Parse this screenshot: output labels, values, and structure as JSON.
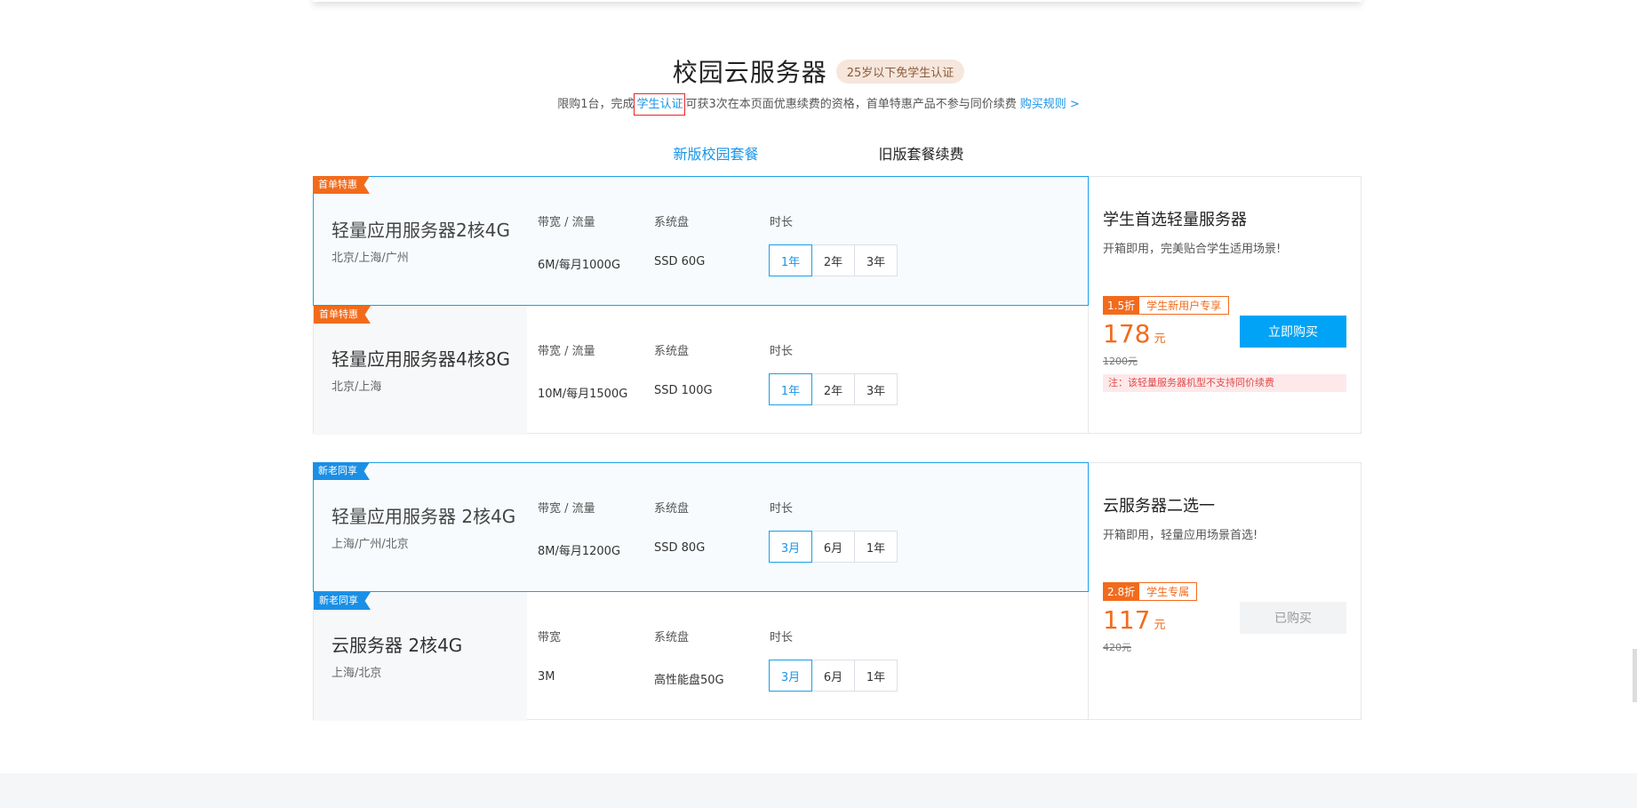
{
  "header": {
    "title": "校园云服务器",
    "badge": "25岁以下免学生认证",
    "sub_before": "限购1台，完成",
    "sub_link": "学生认证",
    "sub_after": "可获3次在本页面优惠续费的资格，首单特惠产品不参与同价续费",
    "sub_rules": "购买规则 >"
  },
  "tabs": [
    {
      "label": "新版校园套餐",
      "active": true
    },
    {
      "label": "旧版套餐续费",
      "active": false
    }
  ],
  "groups": [
    {
      "rows": [
        {
          "tag": "首单特惠",
          "name": "轻量应用服务器2核4G",
          "region": "北京/上海/广州",
          "col1_head": "带宽 / 流量",
          "col1_val": "6M/每月1000G",
          "col2_head": "系统盘",
          "col2_val": "SSD 60G",
          "col3_head": "时长",
          "durations": [
            "1年",
            "2年",
            "3年"
          ]
        },
        {
          "tag": "首单特惠",
          "name": "轻量应用服务器4核8G",
          "region": "北京/上海",
          "col1_head": "带宽 / 流量",
          "col1_val": "10M/每月1500G",
          "col2_head": "系统盘",
          "col2_val": "SSD 100G",
          "col3_head": "时长",
          "durations": [
            "1年",
            "2年",
            "3年"
          ]
        }
      ],
      "panel": {
        "title": "学生首选轻量服务器",
        "desc": "开箱即用，完美贴合学生适用场景!",
        "disc_rate": "1.5折",
        "disc_label": "学生新用户专享",
        "price": "178",
        "unit": "元",
        "orig": "1200元",
        "button": "立即购买",
        "note": "注：该轻量服务器机型不支持同价续费"
      }
    },
    {
      "rows": [
        {
          "tag": "新老同享",
          "name": "轻量应用服务器 2核4G",
          "region": "上海/广州/北京",
          "col1_head": "带宽 / 流量",
          "col1_val": "8M/每月1200G",
          "col2_head": "系统盘",
          "col2_val": "SSD 80G",
          "col3_head": "时长",
          "durations": [
            "3月",
            "6月",
            "1年"
          ]
        },
        {
          "tag": "新老同享",
          "name": "云服务器 2核4G",
          "region": "上海/北京",
          "col1_head": "带宽",
          "col1_val": "3M",
          "col2_head": "系统盘",
          "col2_val": "高性能盘50G",
          "col3_head": "时长",
          "durations": [
            "3月",
            "6月",
            "1年"
          ]
        }
      ],
      "panel": {
        "title": "云服务器二选一",
        "desc": "开箱即用，轻量应用场景首选!",
        "disc_rate": "2.8折",
        "disc_label": "学生专属",
        "price": "117",
        "unit": "元",
        "orig": "420元",
        "button": "已购买"
      }
    }
  ],
  "colors": {
    "accent": "#1a95e6",
    "orange": "#f26b1c",
    "buy": "#00a3f5"
  }
}
